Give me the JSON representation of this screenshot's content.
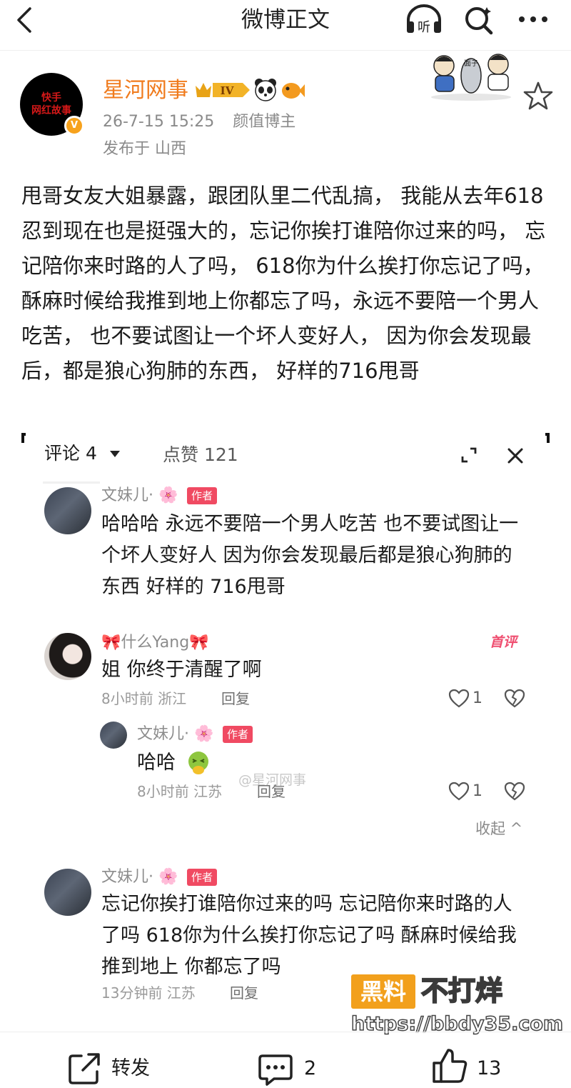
{
  "topbar": {
    "title": "微博正文",
    "listen_label": "听"
  },
  "author": {
    "avatar_text": "快手\n网红故事",
    "name": "星河网事",
    "level_badge": "IV",
    "date": "26-7-15 15:25",
    "role": "颜值博主",
    "location": "发布于 山西"
  },
  "post": {
    "text": "甩哥女友大姐暴露，跟团队里二代乱搞， 我能从去年618忍到现在也是挺强大的，忘记你挨打谁陪你过来的吗， 忘记陪你来时路的人了吗， 618你为什么挨打你忘记了吗， 酥麻时候给我推到地上你都忘了吗，永远不要陪一个男人吃苦， 也不要试图让一个坏人变好人， 因为你会发现最后，都是狼心狗肺的东西， 好样的716甩哥"
  },
  "comments_panel": {
    "tab_comments": "评论 4",
    "tab_likes": "点赞 121",
    "collapse_label": "收起 ^",
    "watermark_small": "@星河网事",
    "items": [
      {
        "name": "文妹儿·",
        "flower": "🌸",
        "tag": "作者",
        "text": "哈哈哈 永远不要陪一个男人吃苦 也不要试图让一个坏人变好人 因为你会发现最后都是狼心狗肺的东西 好样的 716甩哥"
      },
      {
        "name": "🎀什么Yang🎀",
        "first_badge": "首评",
        "text": "姐 你终于清醒了啊",
        "time_loc": "8小时前 浙江",
        "reply_label": "回复",
        "likes": "1"
      },
      {
        "name": "文妹儿·",
        "flower": "🌸",
        "tag": "作者",
        "text": "哈哈",
        "time_loc": "8小时前 江苏",
        "reply_label": "回复",
        "likes": "1"
      },
      {
        "name": "文妹儿·",
        "flower": "🌸",
        "tag": "作者",
        "text": "忘记你挨打谁陪你过来的吗 忘记陪你来时路的人了吗 618你为什么挨打你忘记了吗 酥麻时候给我推到地上 你都忘了吗",
        "time_loc": "13分钟前 江苏",
        "reply_label": "回复"
      }
    ]
  },
  "watermark": {
    "box": "黑料",
    "right": "不打烊",
    "url": "https://bbdy35.com"
  },
  "bottombar": {
    "repost_label": "转发",
    "comment_count": "2",
    "like_count": "13"
  },
  "colors": {
    "username": "#f07b1d",
    "author_tag": "#f04a62",
    "first_badge": "#ef4e70",
    "watermark_box": "#f2a01c"
  }
}
